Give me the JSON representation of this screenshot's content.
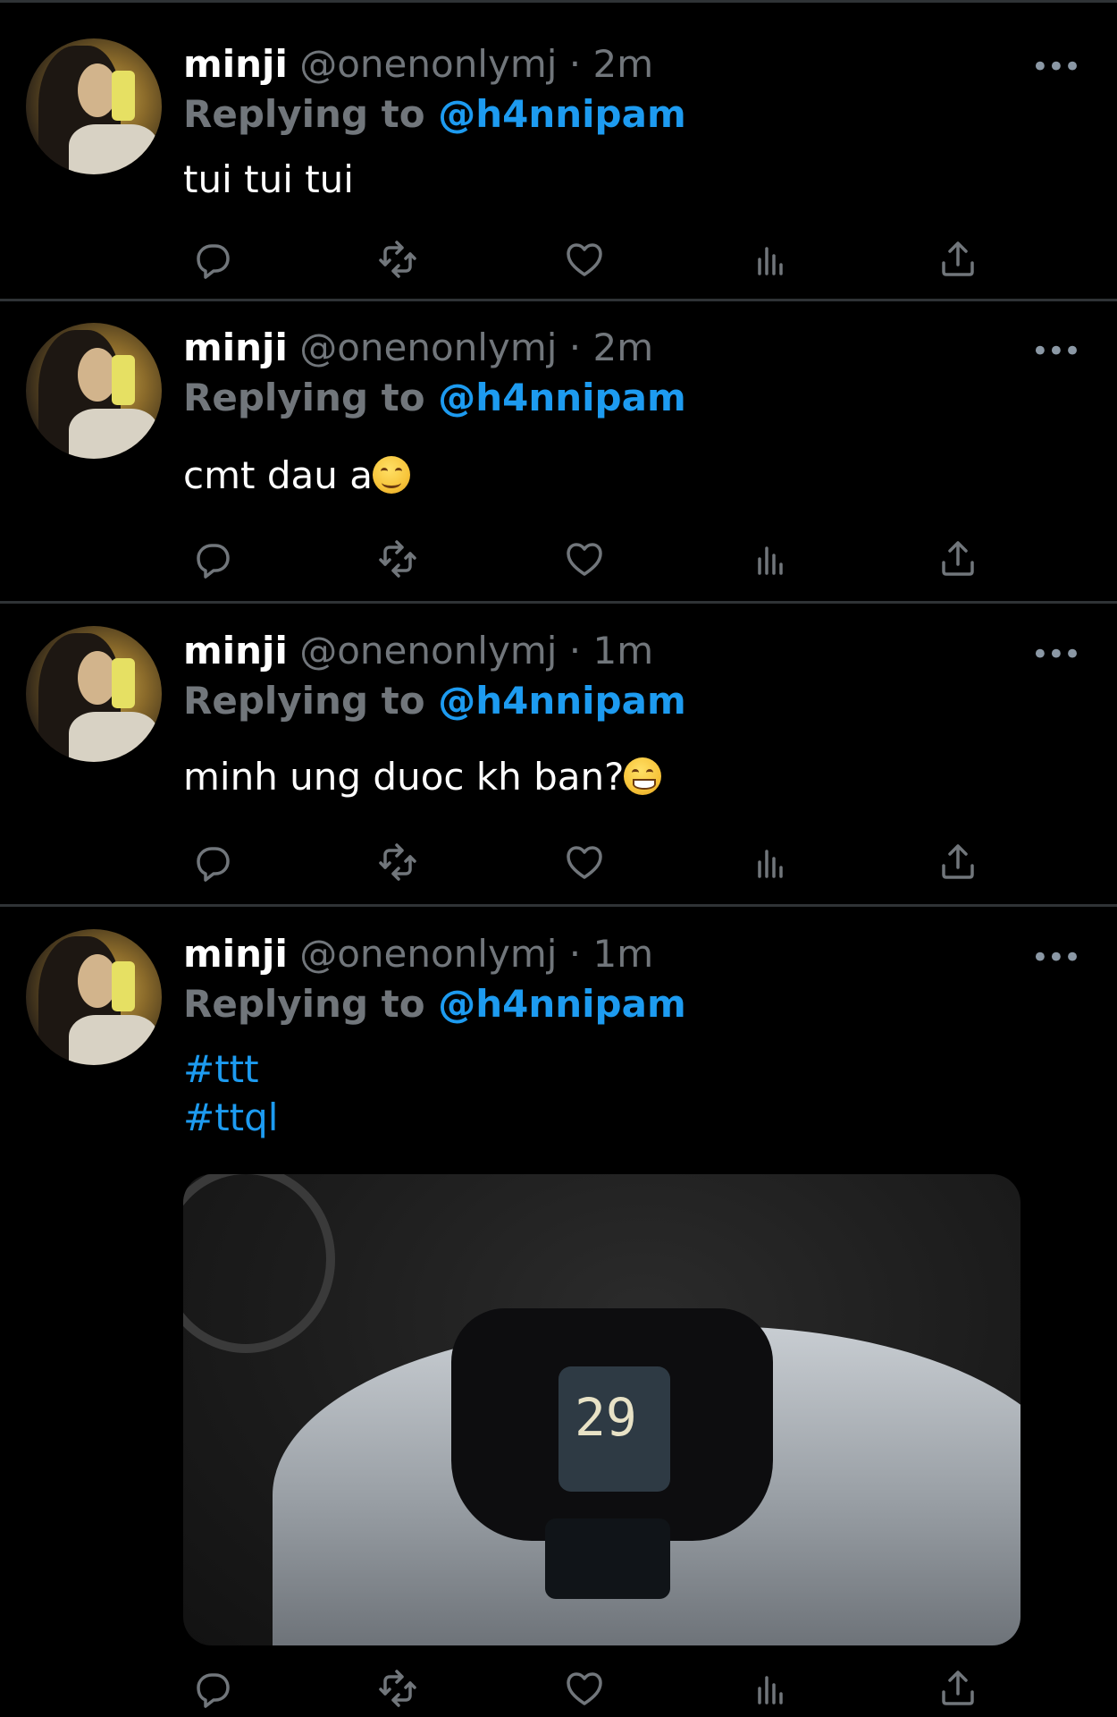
{
  "colors": {
    "background": "#000000",
    "divider": "#2f3336",
    "secondary_text": "#71767b",
    "link": "#1d9bf0"
  },
  "action_icons": [
    "reply-icon",
    "retweet-icon",
    "like-icon",
    "views-icon",
    "share-icon"
  ],
  "tweets": [
    {
      "name": "minji",
      "handle": "@onenonlymj",
      "dot": "·",
      "time": "2m",
      "replying_label": "Replying to",
      "replying_to": "@h4nnipam",
      "text": "tui tui tui",
      "more": "•••"
    },
    {
      "name": "minji",
      "handle": "@onenonlymj",
      "dot": "·",
      "time": "2m",
      "replying_label": "Replying to",
      "replying_to": "@h4nnipam",
      "text": "cmt dau a",
      "emoji": "smiling-face-icon",
      "more": "•••"
    },
    {
      "name": "minji",
      "handle": "@onenonlymj",
      "dot": "·",
      "time": "1m",
      "replying_label": "Replying to",
      "replying_to": "@h4nnipam",
      "text": "minh ung duoc kh ban?",
      "emoji": "grinning-face-icon",
      "more": "•••"
    },
    {
      "name": "minji",
      "handle": "@onenonlymj",
      "dot": "·",
      "time": "1m",
      "replying_label": "Replying to",
      "replying_to": "@h4nnipam",
      "hashtags": [
        "#ttt",
        "#ttql"
      ],
      "media": {
        "speed": "29"
      },
      "more": "•••"
    }
  ]
}
